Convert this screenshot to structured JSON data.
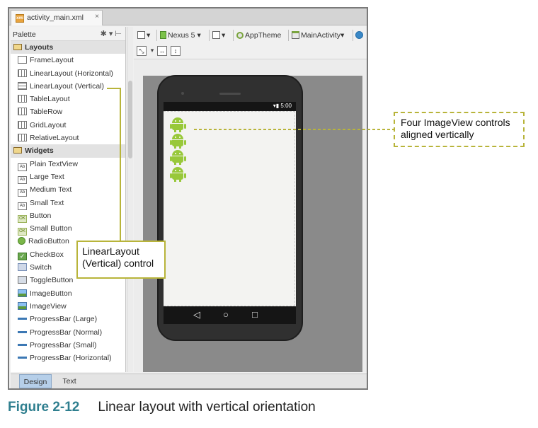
{
  "window": {
    "file_tab": "activity_main.xml",
    "file_tab_close": "×"
  },
  "palette": {
    "title": "Palette",
    "groups": [
      {
        "label": "Layouts",
        "items": [
          "FrameLayout",
          "LinearLayout (Horizontal)",
          "LinearLayout (Vertical)",
          "TableLayout",
          "TableRow",
          "GridLayout",
          "RelativeLayout"
        ]
      },
      {
        "label": "Widgets",
        "items": [
          "Plain TextView",
          "Large Text",
          "Medium Text",
          "Small Text",
          "Button",
          "Small Button",
          "RadioButton",
          "CheckBox",
          "Switch",
          "ToggleButton",
          "ImageButton",
          "ImageView",
          "ProgressBar (Large)",
          "ProgressBar (Normal)",
          "ProgressBar (Small)",
          "ProgressBar (Horizontal)"
        ]
      }
    ]
  },
  "toolbar": {
    "device": "Nexus 5",
    "theme": "AppTheme",
    "activity": "MainActivity"
  },
  "device_preview": {
    "status_time": "5:00"
  },
  "bottom_tabs": [
    {
      "label": "Design",
      "active": true
    },
    {
      "label": "Text",
      "active": false
    }
  ],
  "callouts": {
    "linear_layout": "LinearLayout (Vertical) control",
    "image_views": "Four ImageView controls aligned vertically"
  },
  "figure": {
    "number": "Figure 2-12",
    "caption": "Linear layout with vertical orientation"
  },
  "colors": {
    "callout_border": "#b8b43a",
    "figure_number": "#2f7f8f",
    "android_green": "#98c83a",
    "active_tab": "#b6cfe9"
  }
}
